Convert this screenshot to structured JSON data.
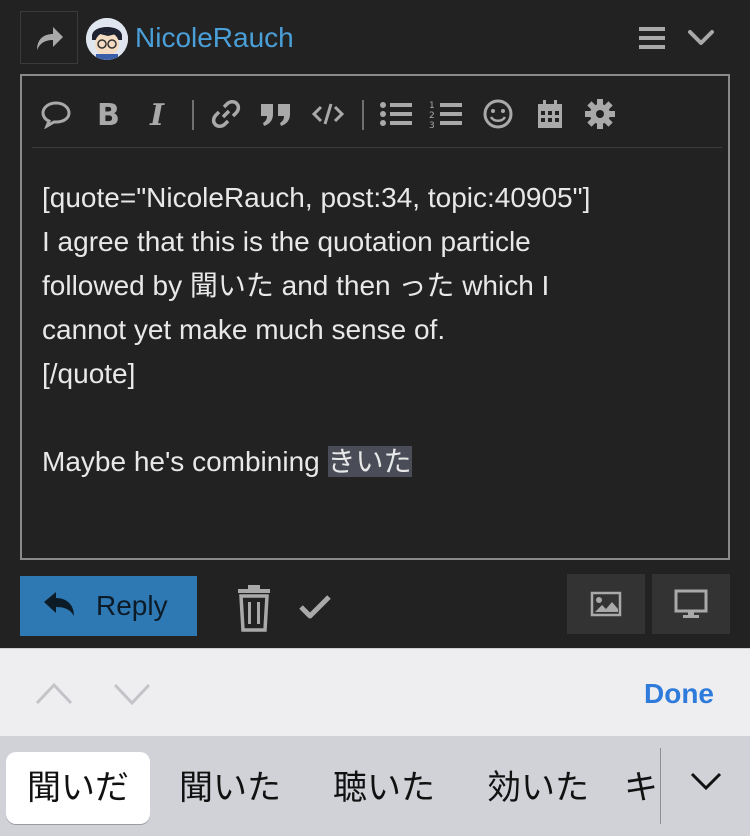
{
  "header": {
    "username": "NicoleRauch"
  },
  "editor": {
    "lines": [
      "[quote=\"NicoleRauch, post:34, topic:40905\"]",
      "I agree that this is the quotation particle",
      "followed by 聞いた and then った which I",
      "cannot yet make much sense of.",
      "[/quote]",
      "",
      "Maybe he's combining "
    ],
    "selected_text": "きいた"
  },
  "footer": {
    "reply_label": "Reply"
  },
  "keyboard_bar": {
    "done_label": "Done"
  },
  "candidates": {
    "items": [
      "聞いだ",
      "聞いた",
      "聴いた",
      "効いた",
      "キ"
    ]
  },
  "colors": {
    "accent": "#2e79b4",
    "username": "#4a9fd8",
    "done": "#2f7bdc",
    "background": "#222222"
  }
}
